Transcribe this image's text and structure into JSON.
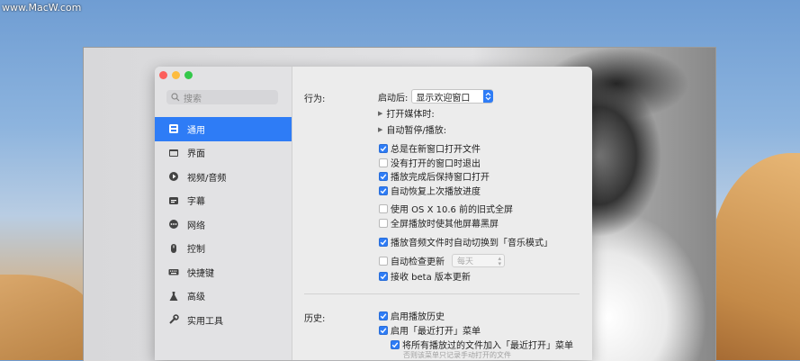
{
  "watermark": "www.MacW.com",
  "sidebar": {
    "search_placeholder": "搜索",
    "items": [
      {
        "label": "通用",
        "icon": "general-icon",
        "active": true
      },
      {
        "label": "界面",
        "icon": "interface-icon"
      },
      {
        "label": "视频/音频",
        "icon": "video-audio-icon"
      },
      {
        "label": "字幕",
        "icon": "subtitle-icon"
      },
      {
        "label": "网络",
        "icon": "network-icon"
      },
      {
        "label": "控制",
        "icon": "control-icon"
      },
      {
        "label": "快捷键",
        "icon": "keyboard-icon"
      },
      {
        "label": "高级",
        "icon": "advanced-icon"
      },
      {
        "label": "实用工具",
        "icon": "utilities-icon"
      }
    ]
  },
  "behavior": {
    "section_label": "行为:",
    "launch_label": "启动后:",
    "launch_value": "显示欢迎窗口",
    "open_media_label": "打开媒体时:",
    "auto_pause_label": "自动暂停/播放:",
    "checkboxes": [
      {
        "label": "总是在新窗口打开文件",
        "checked": true
      },
      {
        "label": "没有打开的窗口时退出",
        "checked": false
      },
      {
        "label": "播放完成后保持窗口打开",
        "checked": true
      },
      {
        "label": "自动恢复上次播放进度",
        "checked": true
      },
      {
        "label": "使用 OS X 10.6 前的旧式全屏",
        "checked": false
      },
      {
        "label": "全屏播放时使其他屏幕黑屏",
        "checked": false
      },
      {
        "label": "播放音频文件时自动切换到「音乐模式」",
        "checked": true
      },
      {
        "label": "自动检查更新",
        "checked": false
      },
      {
        "label": "接收 beta 版本更新",
        "checked": true
      }
    ],
    "update_interval": "每天"
  },
  "history": {
    "section_label": "历史:",
    "checkboxes": [
      {
        "label": "启用播放历史",
        "checked": true
      },
      {
        "label": "启用「最近打开」菜单",
        "checked": true
      },
      {
        "label": "将所有播放过的文件加入「最近打开」菜单",
        "checked": true
      }
    ],
    "hint": "否则该菜单只记录手动打开的文件"
  },
  "colors": {
    "accent": "#2e7cf6"
  }
}
